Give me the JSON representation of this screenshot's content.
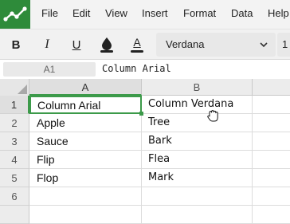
{
  "menu": {
    "items": [
      "File",
      "Edit",
      "View",
      "Insert",
      "Format",
      "Data",
      "Help"
    ]
  },
  "toolbar": {
    "bold": "B",
    "italic": "I",
    "underline": "U",
    "text_color": "A",
    "font_family": "Verdana",
    "font_size": "1"
  },
  "formula_bar": {
    "cell_ref": "A1",
    "content": "Column Arial"
  },
  "grid": {
    "columns": [
      "A",
      "B"
    ],
    "rows": [
      "1",
      "2",
      "3",
      "4",
      "5",
      "6"
    ],
    "cells": [
      [
        "Column Arial",
        "Column Verdana"
      ],
      [
        "Apple",
        "Tree"
      ],
      [
        "Sauce",
        "Bark"
      ],
      [
        "Flip",
        "Flea"
      ],
      [
        "Flop",
        "Mark"
      ],
      [
        "",
        ""
      ]
    ]
  },
  "colors": {
    "brand": "#2e8b3a",
    "selection": "#3c9a4a"
  }
}
